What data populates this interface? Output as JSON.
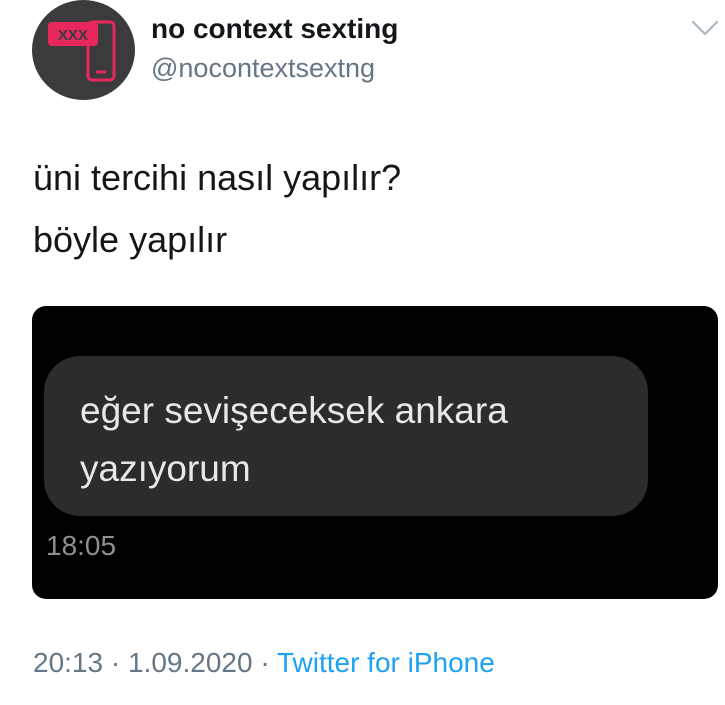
{
  "author": {
    "display_name": "no context sexting",
    "handle": "@nocontextsextng",
    "avatar_badge": "XXX",
    "avatar_bg": "#3b3b3d",
    "avatar_accent": "#e8285d",
    "avatar_icon": "phone-icon"
  },
  "tweet": {
    "lines": [
      "üni tercihi nasıl yapılır?",
      "böyle yapılır"
    ]
  },
  "media": {
    "bubble_lines": [
      "eğer sevişeceksek ankara",
      "yazıyorum"
    ],
    "timestamp": "18:05"
  },
  "meta": {
    "time": "20:13",
    "separator": "·",
    "date": "1.09.2020",
    "source": "Twitter for iPhone",
    "link_color": "#1da1f2"
  }
}
